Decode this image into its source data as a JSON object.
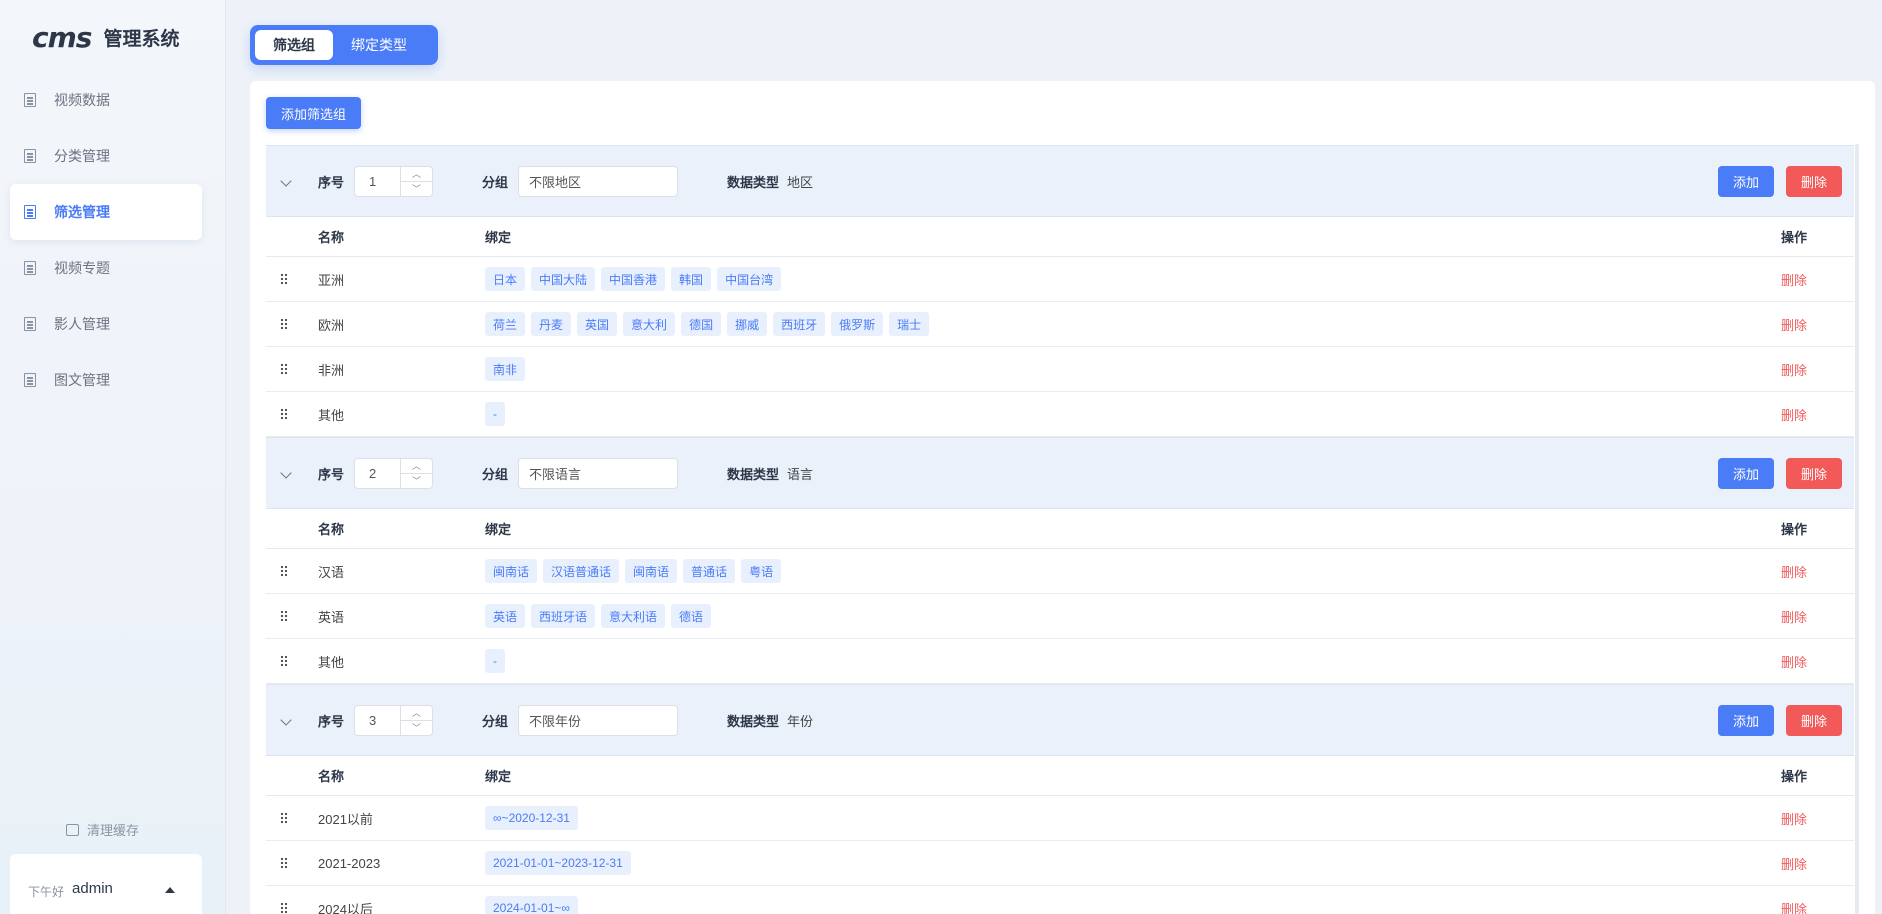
{
  "sidebar": {
    "logo_mark": "cms",
    "logo_text": "管理系统",
    "items": [
      {
        "label": "视频数据",
        "active": false
      },
      {
        "label": "分类管理",
        "active": false
      },
      {
        "label": "筛选管理",
        "active": true
      },
      {
        "label": "视频专题",
        "active": false
      },
      {
        "label": "影人管理",
        "active": false
      },
      {
        "label": "图文管理",
        "active": false
      }
    ],
    "clear_cache": "清理缓存",
    "greeting": "下午好",
    "username": "admin"
  },
  "tabs": [
    {
      "label": "筛选组",
      "active": true
    },
    {
      "label": "绑定类型",
      "active": false
    }
  ],
  "main": {
    "add_group_label": "添加筛选组",
    "labels": {
      "seq": "序号",
      "group": "分组",
      "data_type": "数据类型",
      "add": "添加",
      "delete": "删除",
      "col_name": "名称",
      "col_bind": "绑定",
      "col_op": "操作",
      "row_delete": "删除"
    },
    "groups": [
      {
        "seq": "1",
        "group": "不限地区",
        "data_type": "地区",
        "rows": [
          {
            "name": "亚洲",
            "tags": [
              "日本",
              "中国大陆",
              "中国香港",
              "韩国",
              "中国台湾"
            ]
          },
          {
            "name": "欧洲",
            "tags": [
              "荷兰",
              "丹麦",
              "英国",
              "意大利",
              "德国",
              "挪威",
              "西班牙",
              "俄罗斯",
              "瑞士"
            ]
          },
          {
            "name": "非洲",
            "tags": [
              "南非"
            ]
          },
          {
            "name": "其他",
            "tags": [
              "-"
            ]
          }
        ]
      },
      {
        "seq": "2",
        "group": "不限语言",
        "data_type": "语言",
        "rows": [
          {
            "name": "汉语",
            "tags": [
              "闽南话",
              "汉语普通话",
              "闽南语",
              "普通话",
              "粤语"
            ]
          },
          {
            "name": "英语",
            "tags": [
              "英语",
              "西班牙语",
              "意大利语",
              "德语"
            ]
          },
          {
            "name": "其他",
            "tags": [
              "-"
            ]
          }
        ]
      },
      {
        "seq": "3",
        "group": "不限年份",
        "data_type": "年份",
        "rows": [
          {
            "name": "2021以前",
            "tags": [
              "∞~2020-12-31"
            ]
          },
          {
            "name": "2021-2023",
            "tags": [
              "2021-01-01~2023-12-31"
            ]
          },
          {
            "name": "2024以后",
            "tags": [
              "2024-01-01~∞"
            ]
          }
        ]
      }
    ]
  },
  "colors": {
    "accent": "#4a7cf7",
    "danger": "#f25a5a",
    "tag_bg": "#e9f0fd"
  }
}
